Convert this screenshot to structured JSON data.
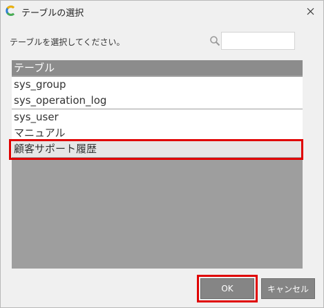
{
  "window": {
    "title": "テーブルの選択",
    "app_icon": "app-logo-icon",
    "close_icon": "close-icon"
  },
  "prompt": "テーブルを選択してください。",
  "search": {
    "icon": "search-icon",
    "value": "",
    "placeholder": ""
  },
  "table_list": {
    "header": "テーブル",
    "items": [
      {
        "label": "sys_group"
      },
      {
        "label": "sys_operation_log"
      },
      {
        "label": "sys_user"
      },
      {
        "label": "マニュアル"
      },
      {
        "label": "顧客サポート履歴",
        "selected": true
      }
    ]
  },
  "buttons": {
    "ok": "OK",
    "cancel": "キャンセル"
  },
  "colors": {
    "highlight": "#e00000",
    "header_bg": "#8c8c8c",
    "list_bg": "#9e9e9e",
    "button_bg": "#858585"
  }
}
